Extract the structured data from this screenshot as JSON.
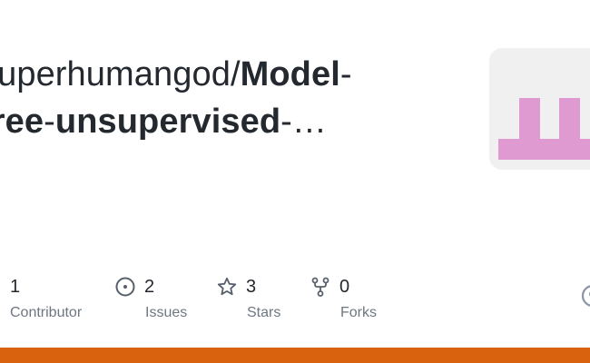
{
  "repo": {
    "owner": "superhumangod/",
    "name_part1": "Model",
    "hyphen1": "-",
    "name_part2": "free",
    "hyphen2": "-",
    "name_part3": "unsupervised",
    "ellipsis": "-…"
  },
  "stats": {
    "contributors": {
      "count": "1",
      "label": "Contributor",
      "icon": "people-icon"
    },
    "issues": {
      "count": "2",
      "label": "Issues",
      "icon": "issue-opened-icon"
    },
    "stars": {
      "count": "3",
      "label": "Stars",
      "icon": "star-icon"
    },
    "forks": {
      "count": "0",
      "label": "Forks",
      "icon": "repo-forked-icon"
    }
  },
  "colors": {
    "accent_bar": "#d9620f",
    "identicon": "#e09ad2",
    "avatar_bg": "#f0f0f0",
    "icon_gray": "#57606a"
  }
}
